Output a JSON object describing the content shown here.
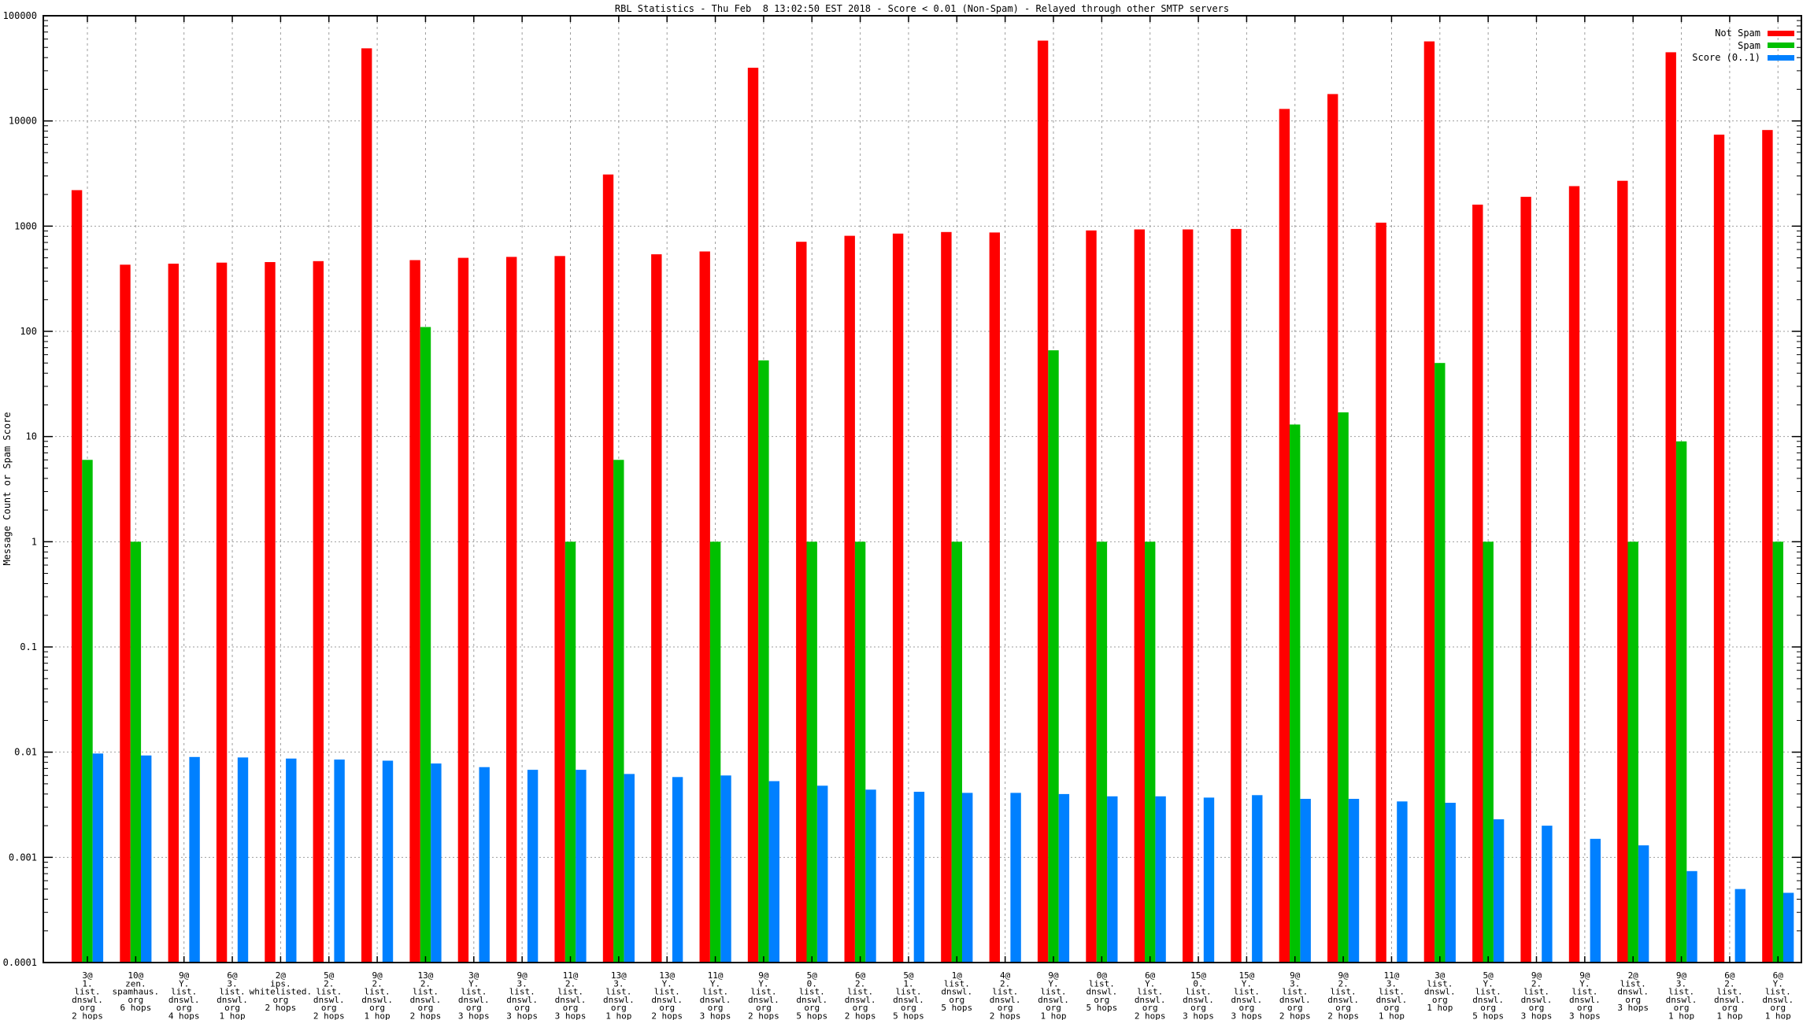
{
  "title": "RBL Statistics - Thu Feb  8 13:02:50 EST 2018 - Score < 0.01 (Non-Spam) - Relayed through other SMTP servers",
  "legend": [
    {
      "label": "Not Spam",
      "color": "#ff0000"
    },
    {
      "label": "Spam",
      "color": "#00c000"
    },
    {
      "label": "Score (0..1)",
      "color": "#0080ff"
    }
  ],
  "chart_data": {
    "type": "bar",
    "title": "RBL Statistics - Thu Feb  8 13:02:50 EST 2018 - Score < 0.01 (Non-Spam) - Relayed through other SMTP servers",
    "ylabel": "Message Count or Spam Score",
    "xlabel": "",
    "y_scale": "log",
    "ylim": [
      0.0001,
      100000
    ],
    "grid": true,
    "legend_position": "top-right-inside",
    "y_tick_labels": [
      "100000",
      "10000",
      "1000",
      "100",
      "10",
      "1",
      "0.1",
      "0.01",
      "0.001",
      "0.0001"
    ],
    "categories": [
      [
        "3@",
        "1.",
        "list.",
        "dnswl.",
        "org",
        "2 hops"
      ],
      [
        "10@",
        "zen.",
        "spamhaus.",
        "org",
        "6 hops"
      ],
      [
        "9@",
        "Y.",
        "list.",
        "dnswl.",
        "org",
        "4 hops"
      ],
      [
        "6@",
        "3.",
        "list.",
        "dnswl.",
        "org",
        "1 hop"
      ],
      [
        "2@",
        "ips.",
        "whitelisted.",
        "org",
        "2 hops"
      ],
      [
        "5@",
        "2.",
        "list.",
        "dnswl.",
        "org",
        "2 hops"
      ],
      [
        "9@",
        "2.",
        "list.",
        "dnswl.",
        "org",
        "1 hop"
      ],
      [
        "13@",
        "2.",
        "list.",
        "dnswl.",
        "org",
        "2 hops"
      ],
      [
        "3@",
        "Y.",
        "list.",
        "dnswl.",
        "org",
        "3 hops"
      ],
      [
        "9@",
        "3.",
        "list.",
        "dnswl.",
        "org",
        "3 hops"
      ],
      [
        "11@",
        "2.",
        "list.",
        "dnswl.",
        "org",
        "3 hops"
      ],
      [
        "13@",
        "3.",
        "list.",
        "dnswl.",
        "org",
        "1 hop"
      ],
      [
        "13@",
        "Y.",
        "list.",
        "dnswl.",
        "org",
        "2 hops"
      ],
      [
        "11@",
        "Y.",
        "list.",
        "dnswl.",
        "org",
        "3 hops"
      ],
      [
        "9@",
        "Y.",
        "list.",
        "dnswl.",
        "org",
        "2 hops"
      ],
      [
        "5@",
        "0.",
        "list.",
        "dnswl.",
        "org",
        "5 hops"
      ],
      [
        "6@",
        "2.",
        "list.",
        "dnswl.",
        "org",
        "2 hops"
      ],
      [
        "5@",
        "1.",
        "list.",
        "dnswl.",
        "org",
        "5 hops"
      ],
      [
        "1@",
        "list.",
        "dnswl.",
        "org",
        "5 hops"
      ],
      [
        "4@",
        "2.",
        "list.",
        "dnswl.",
        "org",
        "2 hops"
      ],
      [
        "9@",
        "Y.",
        "list.",
        "dnswl.",
        "org",
        "1 hop"
      ],
      [
        "0@",
        "list.",
        "dnswl.",
        "org",
        "5 hops"
      ],
      [
        "6@",
        "Y.",
        "list.",
        "dnswl.",
        "org",
        "2 hops"
      ],
      [
        "15@",
        "0.",
        "list.",
        "dnswl.",
        "org",
        "3 hops"
      ],
      [
        "15@",
        "Y.",
        "list.",
        "dnswl.",
        "org",
        "3 hops"
      ],
      [
        "9@",
        "3.",
        "list.",
        "dnswl.",
        "org",
        "2 hops"
      ],
      [
        "9@",
        "2.",
        "list.",
        "dnswl.",
        "org",
        "2 hops"
      ],
      [
        "11@",
        "3.",
        "list.",
        "dnswl.",
        "org",
        "1 hop"
      ],
      [
        "3@",
        "list.",
        "dnswl.",
        "org",
        "1 hop"
      ],
      [
        "5@",
        "Y.",
        "list.",
        "dnswl.",
        "org",
        "5 hops"
      ],
      [
        "9@",
        "2.",
        "list.",
        "dnswl.",
        "org",
        "3 hops"
      ],
      [
        "9@",
        "Y.",
        "list.",
        "dnswl.",
        "org",
        "3 hops"
      ],
      [
        "2@",
        "list.",
        "dnswl.",
        "org",
        "3 hops"
      ],
      [
        "9@",
        "3.",
        "list.",
        "dnswl.",
        "org",
        "1 hop"
      ],
      [
        "6@",
        "2.",
        "list.",
        "dnswl.",
        "org",
        "1 hop"
      ],
      [
        "6@",
        "Y.",
        "list.",
        "dnswl.",
        "org",
        "1 hop"
      ]
    ],
    "series": [
      {
        "name": "Not Spam",
        "color": "#ff0000",
        "values": [
          2200,
          430,
          440,
          450,
          455,
          465,
          49000,
          475,
          500,
          510,
          520,
          3100,
          540,
          575,
          32000,
          710,
          810,
          850,
          880,
          870,
          58000,
          910,
          930,
          930,
          940,
          13000,
          18000,
          1080,
          57000,
          1600,
          1900,
          2400,
          2700,
          45000,
          7400,
          8200
        ]
      },
      {
        "name": "Spam",
        "color": "#00c000",
        "values": [
          6,
          1,
          null,
          null,
          null,
          null,
          null,
          110,
          null,
          null,
          1,
          6,
          null,
          1,
          53,
          1,
          1,
          null,
          1,
          null,
          66,
          1,
          1,
          null,
          null,
          13,
          17,
          null,
          50,
          1,
          null,
          null,
          1,
          9,
          null,
          1
        ]
      },
      {
        "name": "Score (0..1)",
        "color": "#0080ff",
        "values": [
          0.0097,
          0.0093,
          0.009,
          0.0089,
          0.0087,
          0.0085,
          0.0083,
          0.0078,
          0.0072,
          0.0068,
          0.0068,
          0.0062,
          0.0058,
          0.006,
          0.0053,
          0.0048,
          0.0044,
          0.0042,
          0.0041,
          0.0041,
          0.004,
          0.0038,
          0.0038,
          0.0037,
          0.0039,
          0.0036,
          0.0036,
          0.0034,
          0.0033,
          0.0023,
          0.002,
          0.0015,
          0.0013,
          0.00074,
          0.0005,
          0.00046
        ]
      }
    ]
  }
}
